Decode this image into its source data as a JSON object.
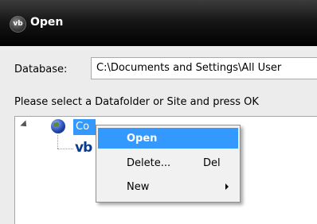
{
  "window": {
    "title": "Open",
    "app_icon_text": "vb"
  },
  "database": {
    "label": "Database:",
    "value": "C:\\Documents and Settings\\All User"
  },
  "prompt": "Please select a Datafolder or Site and press OK",
  "tree": {
    "root_label": "Co",
    "child_icon_text": "vb"
  },
  "context_menu": {
    "items": [
      {
        "label": "Open",
        "shortcut": ""
      },
      {
        "label": "Delete...",
        "shortcut": "Del"
      },
      {
        "label": "New",
        "shortcut": ""
      }
    ]
  },
  "colors": {
    "titlebar": "#000000",
    "selection": "#3399ff",
    "dialog_bg": "#ececec"
  }
}
